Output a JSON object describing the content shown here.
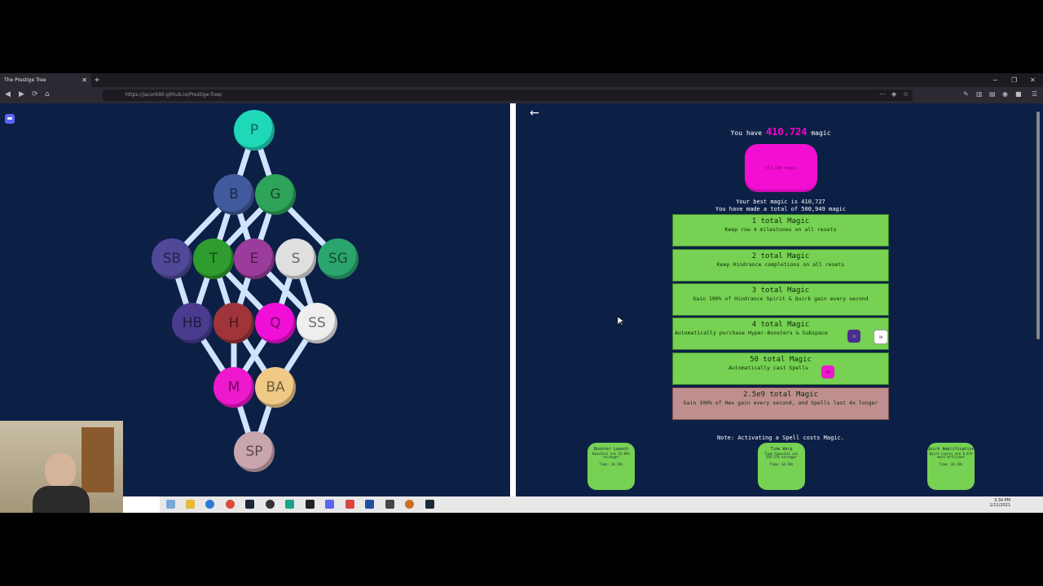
{
  "browser": {
    "tab_title": "The Prestige Tree",
    "tab_close": "✕",
    "new_tab": "+",
    "url": "https://jacorb90.github.io/Prestige-Tree/",
    "minimize": "─",
    "maximize": "❐",
    "close": "✕"
  },
  "tree": {
    "nodes": [
      {
        "id": "P",
        "label": "P",
        "color": "#1fd8b8"
      },
      {
        "id": "B",
        "label": "B",
        "color": "#415a9e"
      },
      {
        "id": "G",
        "label": "G",
        "color": "#2ea35a"
      },
      {
        "id": "SB",
        "label": "SB",
        "color": "#504899"
      },
      {
        "id": "T",
        "label": "T",
        "color": "#2e9c2e"
      },
      {
        "id": "E",
        "label": "E",
        "color": "#9b3c9c"
      },
      {
        "id": "S",
        "label": "S",
        "color": "#dfdfdf"
      },
      {
        "id": "SG",
        "label": "SG",
        "color": "#2ba56e"
      },
      {
        "id": "HB",
        "label": "HB",
        "color": "#4a3b8f"
      },
      {
        "id": "H",
        "label": "H",
        "color": "#a0343b"
      },
      {
        "id": "Q",
        "label": "Q",
        "color": "#f00fd6"
      },
      {
        "id": "SS",
        "label": "SS",
        "color": "#eeeeee"
      },
      {
        "id": "M",
        "label": "M",
        "color": "#ee18cc"
      },
      {
        "id": "BA",
        "label": "BA",
        "color": "#f0c986"
      },
      {
        "id": "SP",
        "label": "SP",
        "color": "#c9a5ae"
      }
    ]
  },
  "panel": {
    "back_arrow": "←",
    "you_have": "You have",
    "amount": "410,724",
    "currency": "magic",
    "reset_gain": "+53,590 magic",
    "best_line": "Your best magic is 410,727",
    "total_line": "You have made a total of 500,949 magic",
    "milestones": [
      {
        "title": "1 total Magic",
        "desc": "Keep row 4 milestones on all resets",
        "done": true
      },
      {
        "title": "2 total Magic",
        "desc": "Keep Hindrance completions on all resets",
        "done": true
      },
      {
        "title": "3 total Magic",
        "desc": "Gain 100% of Hindrance Spirit & Quirk gain every second",
        "done": true
      },
      {
        "title": "4 total Magic",
        "desc": "Automatically purchase Hyper-Boosters & Subspace",
        "done": true
      },
      {
        "title": "50 total Magic",
        "desc": "Automatically cast Spells",
        "done": true
      },
      {
        "title": "2.5e9 total Magic",
        "desc": "Gain 100% of Hex gain every second, and Spells last 4x longer",
        "done": false
      }
    ],
    "toggle_on": "ON",
    "note": "Note: Activating a Spell costs Magic.",
    "spells": [
      {
        "name": "Booster Launch",
        "effect": "Boosters are 32.93% stronger",
        "time": "Time: 34.19s"
      },
      {
        "name": "Time Warp",
        "effect": "Time Capsules are 259.57% stronger",
        "time": "Time: 34.19s"
      },
      {
        "name": "Quirk Amplification",
        "effect": "Quirk Layers are 9.47% more efficient",
        "time": "Time: 34.19s"
      }
    ]
  },
  "taskbar": {
    "time": "3:34 PM",
    "date": "1/11/2021"
  }
}
